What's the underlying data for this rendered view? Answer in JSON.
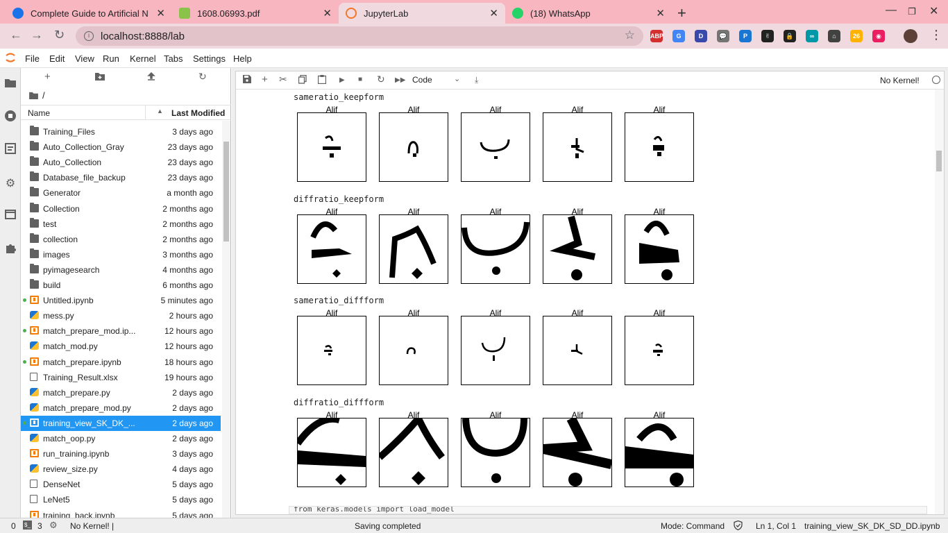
{
  "browser": {
    "tabs": [
      {
        "title": "Complete Guide to Artificial N",
        "favicon_color": "#1a73e8",
        "active": false
      },
      {
        "title": "1608.06993.pdf",
        "favicon_color": "#8bc34a",
        "active": false
      },
      {
        "title": "JupyterLab",
        "favicon_color": "#f37726",
        "active": true
      },
      {
        "title": "(18) WhatsApp",
        "favicon_color": "#25d366",
        "active": false
      }
    ],
    "url": "localhost:8888/lab",
    "extensions": [
      {
        "name": "ABP",
        "color": "#d32f2f"
      },
      {
        "name": "G",
        "color": "#4285f4"
      },
      {
        "name": "D",
        "color": "#3949ab"
      },
      {
        "name": "💬",
        "color": "#757575"
      },
      {
        "name": "P",
        "color": "#1976d2"
      },
      {
        "name": "✌",
        "color": "#222222"
      },
      {
        "name": "🔒",
        "color": "#222222"
      },
      {
        "name": "∞",
        "color": "#0097a7"
      },
      {
        "name": "⌂",
        "color": "#424242"
      },
      {
        "name": "26",
        "color": "#ffb300"
      },
      {
        "name": "◉",
        "color": "#e91e63"
      }
    ]
  },
  "menu": [
    "File",
    "Edit",
    "View",
    "Run",
    "Kernel",
    "Tabs",
    "Settings",
    "Help"
  ],
  "filebrowser": {
    "path": "/",
    "header_name": "Name",
    "header_modified": "Last Modified",
    "files": [
      {
        "name": "Training_Files",
        "date": "3 days ago",
        "type": "folder",
        "running": false,
        "selected": false
      },
      {
        "name": "Auto_Collection_Gray",
        "date": "23 days ago",
        "type": "folder",
        "running": false,
        "selected": false
      },
      {
        "name": "Auto_Collection",
        "date": "23 days ago",
        "type": "folder",
        "running": false,
        "selected": false
      },
      {
        "name": "Database_file_backup",
        "date": "23 days ago",
        "type": "folder",
        "running": false,
        "selected": false
      },
      {
        "name": "Generator",
        "date": "a month ago",
        "type": "folder",
        "running": false,
        "selected": false
      },
      {
        "name": "Collection",
        "date": "2 months ago",
        "type": "folder",
        "running": false,
        "selected": false
      },
      {
        "name": "test",
        "date": "2 months ago",
        "type": "folder",
        "running": false,
        "selected": false
      },
      {
        "name": "collection",
        "date": "2 months ago",
        "type": "folder",
        "running": false,
        "selected": false
      },
      {
        "name": "images",
        "date": "3 months ago",
        "type": "folder",
        "running": false,
        "selected": false
      },
      {
        "name": "pyimagesearch",
        "date": "4 months ago",
        "type": "folder",
        "running": false,
        "selected": false
      },
      {
        "name": "build",
        "date": "6 months ago",
        "type": "folder",
        "running": false,
        "selected": false
      },
      {
        "name": "Untitled.ipynb",
        "date": "5 minutes ago",
        "type": "notebook",
        "running": true,
        "selected": false
      },
      {
        "name": "mess.py",
        "date": "2 hours ago",
        "type": "python",
        "running": false,
        "selected": false
      },
      {
        "name": "match_prepare_mod.ip...",
        "date": "12 hours ago",
        "type": "notebook",
        "running": true,
        "selected": false
      },
      {
        "name": "match_mod.py",
        "date": "12 hours ago",
        "type": "python",
        "running": false,
        "selected": false
      },
      {
        "name": "match_prepare.ipynb",
        "date": "18 hours ago",
        "type": "notebook",
        "running": true,
        "selected": false
      },
      {
        "name": "Training_Result.xlsx",
        "date": "19 hours ago",
        "type": "file",
        "running": false,
        "selected": false
      },
      {
        "name": "match_prepare.py",
        "date": "2 days ago",
        "type": "python",
        "running": false,
        "selected": false
      },
      {
        "name": "match_prepare_mod.py",
        "date": "2 days ago",
        "type": "python",
        "running": false,
        "selected": false
      },
      {
        "name": "training_view_SK_DK_...",
        "date": "2 days ago",
        "type": "notebook",
        "running": true,
        "selected": true
      },
      {
        "name": "match_oop.py",
        "date": "2 days ago",
        "type": "python",
        "running": false,
        "selected": false
      },
      {
        "name": "run_training.ipynb",
        "date": "3 days ago",
        "type": "notebook",
        "running": false,
        "selected": false
      },
      {
        "name": "review_size.py",
        "date": "4 days ago",
        "type": "python",
        "running": false,
        "selected": false
      },
      {
        "name": "DenseNet",
        "date": "5 days ago",
        "type": "file",
        "running": false,
        "selected": false
      },
      {
        "name": "LeNet5",
        "date": "5 days ago",
        "type": "file",
        "running": false,
        "selected": false
      },
      {
        "name": "training_back.ipynb",
        "date": "5 days ago",
        "type": "notebook",
        "running": false,
        "selected": false
      }
    ]
  },
  "notebook": {
    "cell_type": "Code",
    "kernel": "No Kernel!",
    "sections": [
      {
        "label": "sameratio_keepform",
        "titles": [
          "Alif",
          "Alif",
          "Alif",
          "Alif",
          "Alif"
        ]
      },
      {
        "label": "diffratio_keepform",
        "titles": [
          "Alif",
          "Alif",
          "Alif",
          "Alif",
          "Alif"
        ]
      },
      {
        "label": "sameratio_diffform",
        "titles": [
          "Alif",
          "Alif",
          "Alif",
          "Alif",
          "Alif"
        ]
      },
      {
        "label": "diffratio_diffform",
        "titles": [
          "Alif",
          "Alif",
          "Alif",
          "Alif",
          "Alif"
        ]
      }
    ],
    "next_cell_prompt": "[ ]:",
    "next_cell_code": "from keras.models import load_model"
  },
  "statusbar": {
    "left_count": "0",
    "terminal_count": "3",
    "kernel_status": "No Kernel! |",
    "message": "Saving completed",
    "mode": "Mode: Command",
    "cursor": "Ln 1, Col 1",
    "filename": "training_view_SK_DK_SD_DD.ipynb"
  }
}
